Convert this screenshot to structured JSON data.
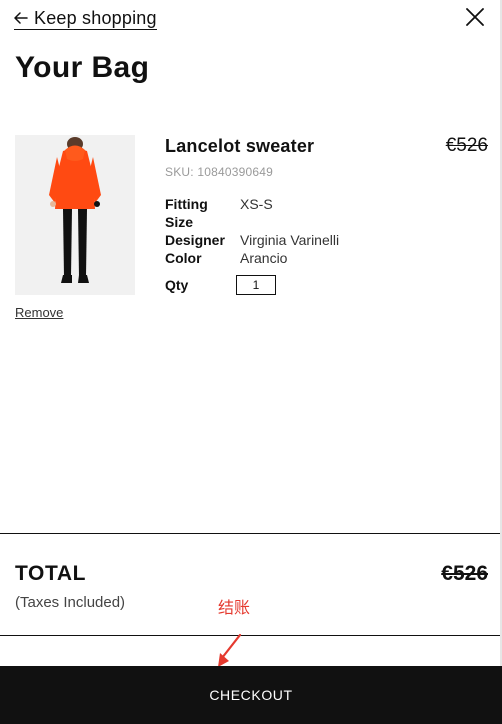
{
  "header": {
    "back_label": "Keep shopping",
    "title": "Your Bag"
  },
  "item": {
    "name": "Lancelot sweater",
    "price": "€526",
    "sku": "SKU: 10840390649",
    "attributes": [
      {
        "key": "Fitting",
        "value": "XS-S"
      },
      {
        "key": "Size",
        "value": ""
      },
      {
        "key": "Designer",
        "value": "Virginia Varinelli"
      },
      {
        "key": "Color",
        "value": "Arancio"
      }
    ],
    "qty_label": "Qty",
    "qty_value": "1",
    "remove_label": "Remove",
    "image_colors": {
      "background": "#f1f1f1",
      "sweater": "#ff4a12",
      "boots": "#111111"
    }
  },
  "summary": {
    "total_label": "TOTAL",
    "total_price": "€526",
    "taxes_note": "(Taxes Included)"
  },
  "annotation": {
    "label": "结账",
    "color": "#e53a2f",
    "arrow_icon": "red-pointer-arrow"
  },
  "checkout": {
    "label": "CHECKOUT"
  },
  "icons": {
    "back": "arrow-left-icon",
    "close": "close-icon"
  }
}
